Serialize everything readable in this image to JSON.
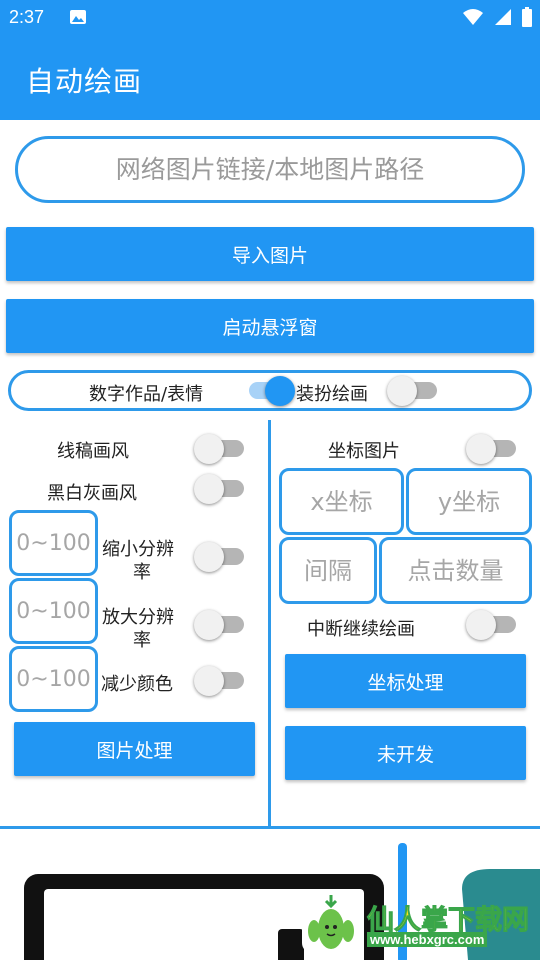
{
  "status_bar": {
    "time": "2:37",
    "icons": [
      "gallery-icon",
      "wifi-icon",
      "signal-icon",
      "battery-icon"
    ]
  },
  "app_bar": {
    "title": "自动绘画"
  },
  "url_input": {
    "placeholder": "网络图片链接/本地图片路径",
    "value": ""
  },
  "buttons": {
    "import": "导入图片",
    "float": "启动悬浮窗"
  },
  "mode": {
    "left_label": "数字作品/表情",
    "right_label": "装扮绘画",
    "left_on": true,
    "right_on": false
  },
  "left_panel": {
    "line_style": {
      "label": "线稿画风",
      "on": false
    },
    "bw_style": {
      "label": "黑白灰画风",
      "on": false
    },
    "shrink": {
      "placeholder": "0~100",
      "label_line1": "缩小分辨",
      "label_line2": "率",
      "on": false
    },
    "enlarge": {
      "placeholder": "0~100",
      "label_line1": "放大分辨",
      "label_line2": "率",
      "on": false
    },
    "reduce_color": {
      "placeholder": "0~100",
      "label": "减少颜色",
      "on": false
    },
    "process_button": "图片处理"
  },
  "right_panel": {
    "coord_image": {
      "label": "坐标图片",
      "on": false
    },
    "x_placeholder": "x坐标",
    "y_placeholder": "y坐标",
    "interval_placeholder": "间隔",
    "click_count_placeholder": "点击数量",
    "resume": {
      "label": "中断继续绘画",
      "on": false
    },
    "coord_button": "坐标处理",
    "undeveloped_button": "未开发"
  },
  "watermark": {
    "title": "仙人掌下载网",
    "url": "www.hebxgrc.com"
  },
  "colors": {
    "primary": "#2196f3",
    "border": "#2e9aea",
    "watermark_yellow": "#ffe61a",
    "watermark_green": "#3aa64a"
  }
}
